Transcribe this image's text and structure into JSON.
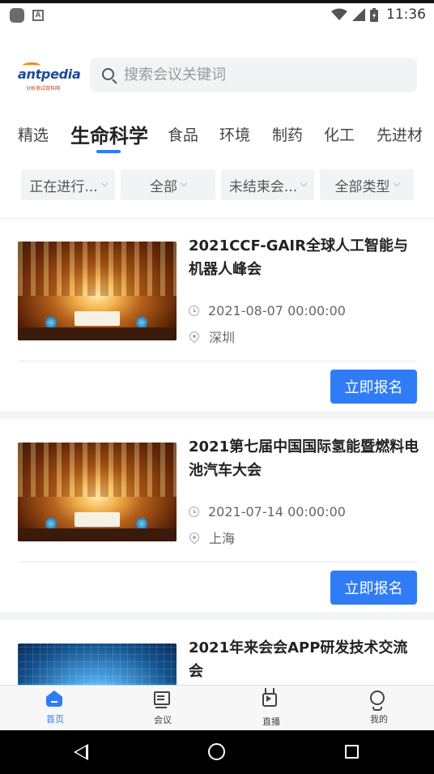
{
  "status_bar": {
    "time": "11:36",
    "notif_letter": "A"
  },
  "header": {
    "logo_text": "antpedia",
    "logo_sub": "分析测试百科网",
    "search_placeholder": "搜索会议关键词"
  },
  "tabs": [
    {
      "label": "精选",
      "active": false
    },
    {
      "label": "生命科学",
      "active": true
    },
    {
      "label": "食品",
      "active": false
    },
    {
      "label": "环境",
      "active": false
    },
    {
      "label": "制药",
      "active": false
    },
    {
      "label": "化工",
      "active": false
    },
    {
      "label": "先进材",
      "active": false
    }
  ],
  "filters": [
    {
      "label": "正在进行..."
    },
    {
      "label": "全部"
    },
    {
      "label": "未结束会..."
    },
    {
      "label": "全部类型"
    }
  ],
  "conferences": [
    {
      "title": "2021CCF-GAIR全球人工智能与机器人峰会",
      "date": "2021-08-07 00:00:00",
      "city": "深圳",
      "button": "立即报名"
    },
    {
      "title": "2021第七届中国国际氢能暨燃料电池汽车大会",
      "date": "2021-07-14 00:00:00",
      "city": "上海",
      "button": "立即报名"
    },
    {
      "title": "2021年来会会APP研发技术交流会"
    }
  ],
  "bottom_nav": [
    {
      "label": "首页",
      "icon": "home-icon",
      "active": true
    },
    {
      "label": "会议",
      "icon": "meeting-icon",
      "active": false
    },
    {
      "label": "直播",
      "icon": "live-icon",
      "active": false
    },
    {
      "label": "我的",
      "icon": "mine-icon",
      "active": false
    }
  ],
  "colors": {
    "accent": "#2f7cf6",
    "tab_underline": "#2f7cf6"
  }
}
